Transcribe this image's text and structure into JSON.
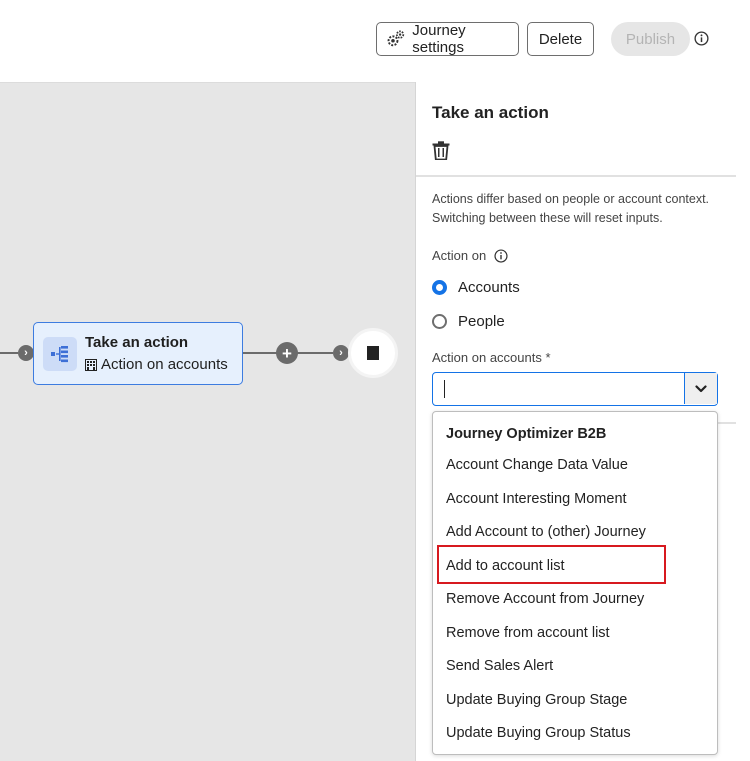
{
  "toolbar": {
    "settings_label": "Journey settings",
    "settings_icon": "gears-icon",
    "delete_label": "Delete",
    "publish_label": "Publish",
    "info_icon": "info-icon"
  },
  "canvas": {
    "node": {
      "title": "Take an action",
      "subtitle": "Action on accounts",
      "icon": "workflow-icon",
      "subtitle_icon": "building-icon"
    },
    "connector_symbol": "›",
    "add_symbol": "+"
  },
  "panel": {
    "title": "Take an action",
    "description": "Actions differ based on people or account context. Switching between these will reset inputs.",
    "action_on_label": "Action on",
    "radio_options": [
      {
        "label": "Accounts",
        "checked": true
      },
      {
        "label": "People",
        "checked": false
      }
    ],
    "action_on_accounts_label": "Action on accounts *",
    "picker_value": ""
  },
  "dropdown": {
    "header": "Journey Optimizer B2B",
    "items": [
      "Account Change Data Value",
      "Account Interesting Moment",
      "Add Account to (other) Journey",
      "Add to account list",
      "Remove Account from Journey",
      "Remove from account list",
      "Send Sales Alert",
      "Update Buying Group Stage",
      "Update Buying Group Status"
    ],
    "highlighted_item": "Add to account list"
  },
  "colors": {
    "accent": "#1473e6",
    "highlight": "#d7191f",
    "canvas_bg": "#e6e6e6",
    "node_bg": "#e6f0fd"
  }
}
